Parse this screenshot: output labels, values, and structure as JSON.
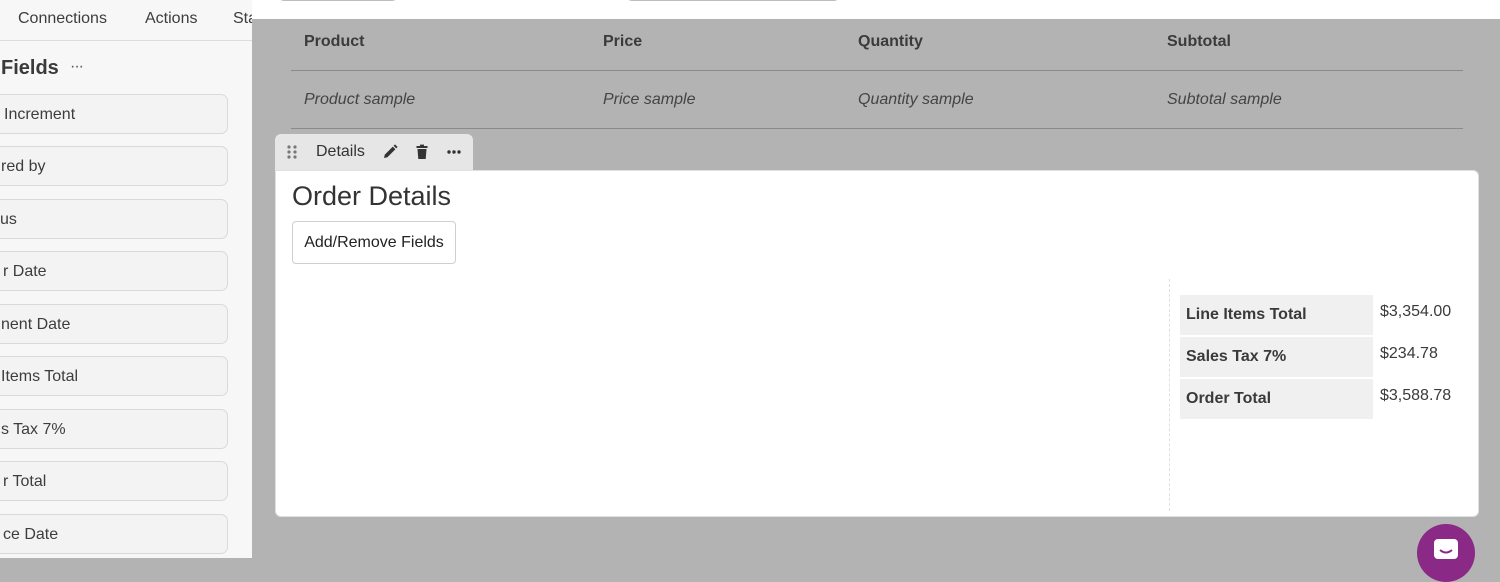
{
  "left_panel": {
    "tabs": [
      "Connections",
      "Actions",
      "Sta"
    ],
    "section_title": "Fields",
    "section_menu": "···",
    "fields": [
      "Increment",
      "red by",
      "us",
      "r Date",
      "nent Date",
      "Items Total",
      "s Tax 7%",
      "r Total",
      "ce Date"
    ]
  },
  "table": {
    "headers": [
      "Product",
      "Price",
      "Quantity",
      "Subtotal"
    ],
    "row": [
      "Product sample",
      "Price sample",
      "Quantity sample",
      "Subtotal sample"
    ]
  },
  "view_toolbar": {
    "label": "Details",
    "menu": "···",
    "icons": [
      "drag-handle-icon",
      "pencil-icon",
      "trash-icon",
      "more-icon"
    ]
  },
  "details": {
    "title": "Order Details",
    "add_remove_label": "Add/Remove Fields",
    "summary": [
      {
        "label": "Line Items Total",
        "value": "$3,354.00"
      },
      {
        "label": "Sales Tax 7%",
        "value": "$234.78"
      },
      {
        "label": "Order Total",
        "value": "$3,588.78"
      }
    ]
  },
  "colors": {
    "overlay": "#b3b3b3",
    "chat_bubble": "#8a2a86"
  }
}
